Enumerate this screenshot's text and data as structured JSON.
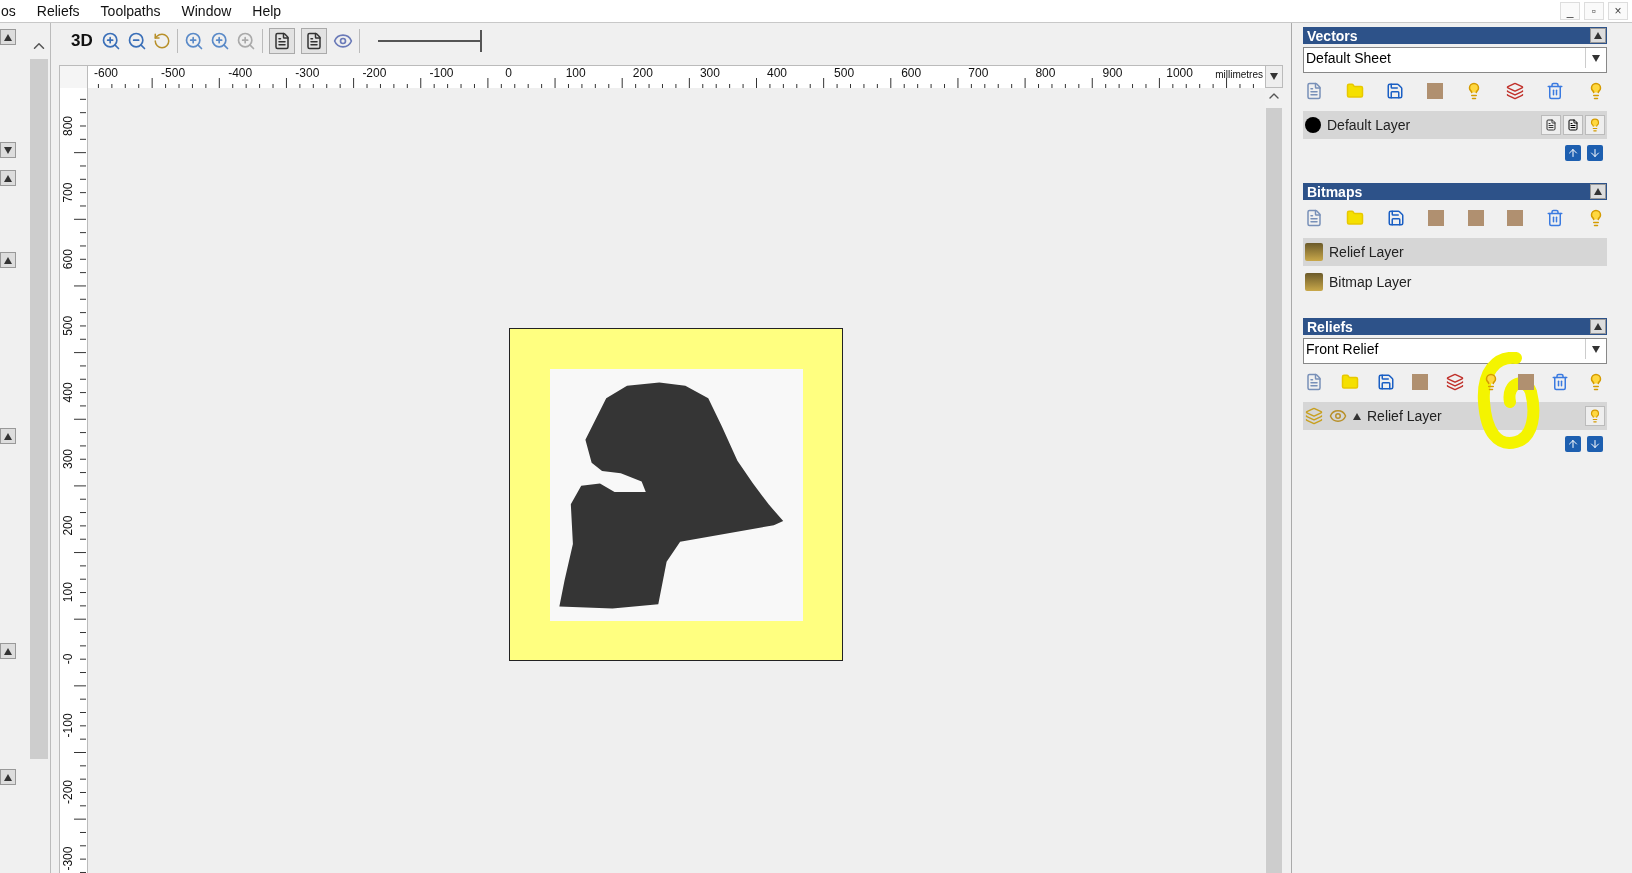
{
  "menu": [
    {
      "label": "os"
    },
    {
      "label": "Reliefs"
    },
    {
      "label": "Toolpaths"
    },
    {
      "label": "Window"
    },
    {
      "label": "Help"
    }
  ],
  "window_controls": [
    "_",
    "▫",
    "×"
  ],
  "toolbar": {
    "view_3d": "3D",
    "toggles": [
      {
        "selected": true
      },
      {
        "selected": true
      }
    ],
    "zoom_slider": {
      "level": 1
    }
  },
  "ruler": {
    "x_labels": [
      "-600",
      "-500",
      "-400",
      "-300",
      "-200",
      "-100",
      "0",
      "100",
      "200",
      "300",
      "400",
      "500",
      "600",
      "700",
      "800",
      "900",
      "1000"
    ],
    "unit": "millimetres",
    "y_labels": [
      "800",
      "700",
      "600",
      "500",
      "400",
      "300",
      "200",
      "100",
      "-0",
      "-100",
      "-200",
      "-300"
    ]
  },
  "panels": [
    {
      "kind": "vectors",
      "title": "Vectors",
      "sheet": "Default Sheet",
      "layers": [
        {
          "name": "Default Layer",
          "selected": true
        }
      ]
    },
    {
      "kind": "bitmaps",
      "title": "Bitmaps",
      "layers": [
        {
          "name": "Relief Layer",
          "selected": true
        },
        {
          "name": "Bitmap Layer",
          "selected": false
        }
      ]
    },
    {
      "kind": "reliefs",
      "title": "Reliefs",
      "sheet": "Front Relief",
      "layers": [
        {
          "name": "Relief Layer",
          "selected": true
        }
      ]
    }
  ]
}
